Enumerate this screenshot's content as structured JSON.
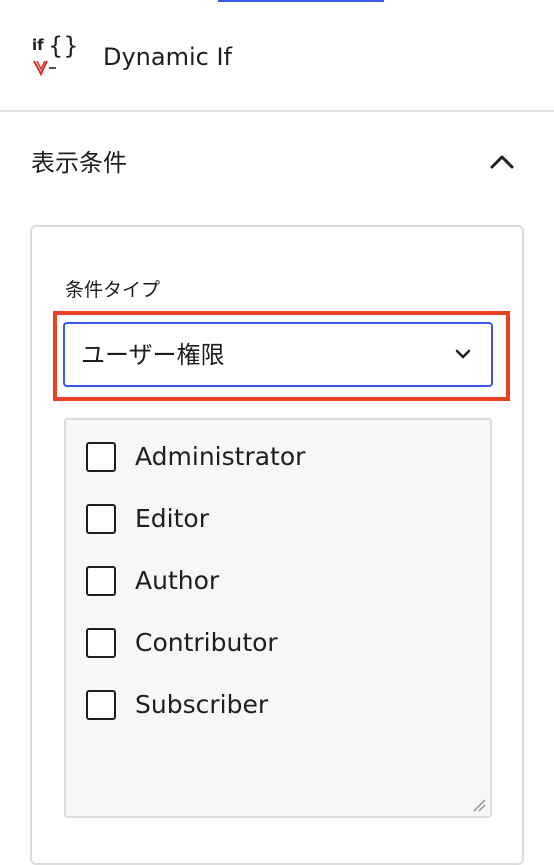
{
  "block": {
    "title": "Dynamic If",
    "logo_text_top": "if",
    "logo_braces": "{}"
  },
  "panel": {
    "title": "表示条件",
    "expanded": true
  },
  "condition_type": {
    "label": "条件タイプ",
    "selected": "ユーザー権限"
  },
  "roles": [
    {
      "label": "Administrator",
      "checked": false
    },
    {
      "label": "Editor",
      "checked": false
    },
    {
      "label": "Author",
      "checked": false
    },
    {
      "label": "Contributor",
      "checked": false
    },
    {
      "label": "Subscriber",
      "checked": false
    }
  ],
  "colors": {
    "accent": "#3858e9",
    "highlight": "#e74025",
    "logo_red": "#d0342c"
  }
}
